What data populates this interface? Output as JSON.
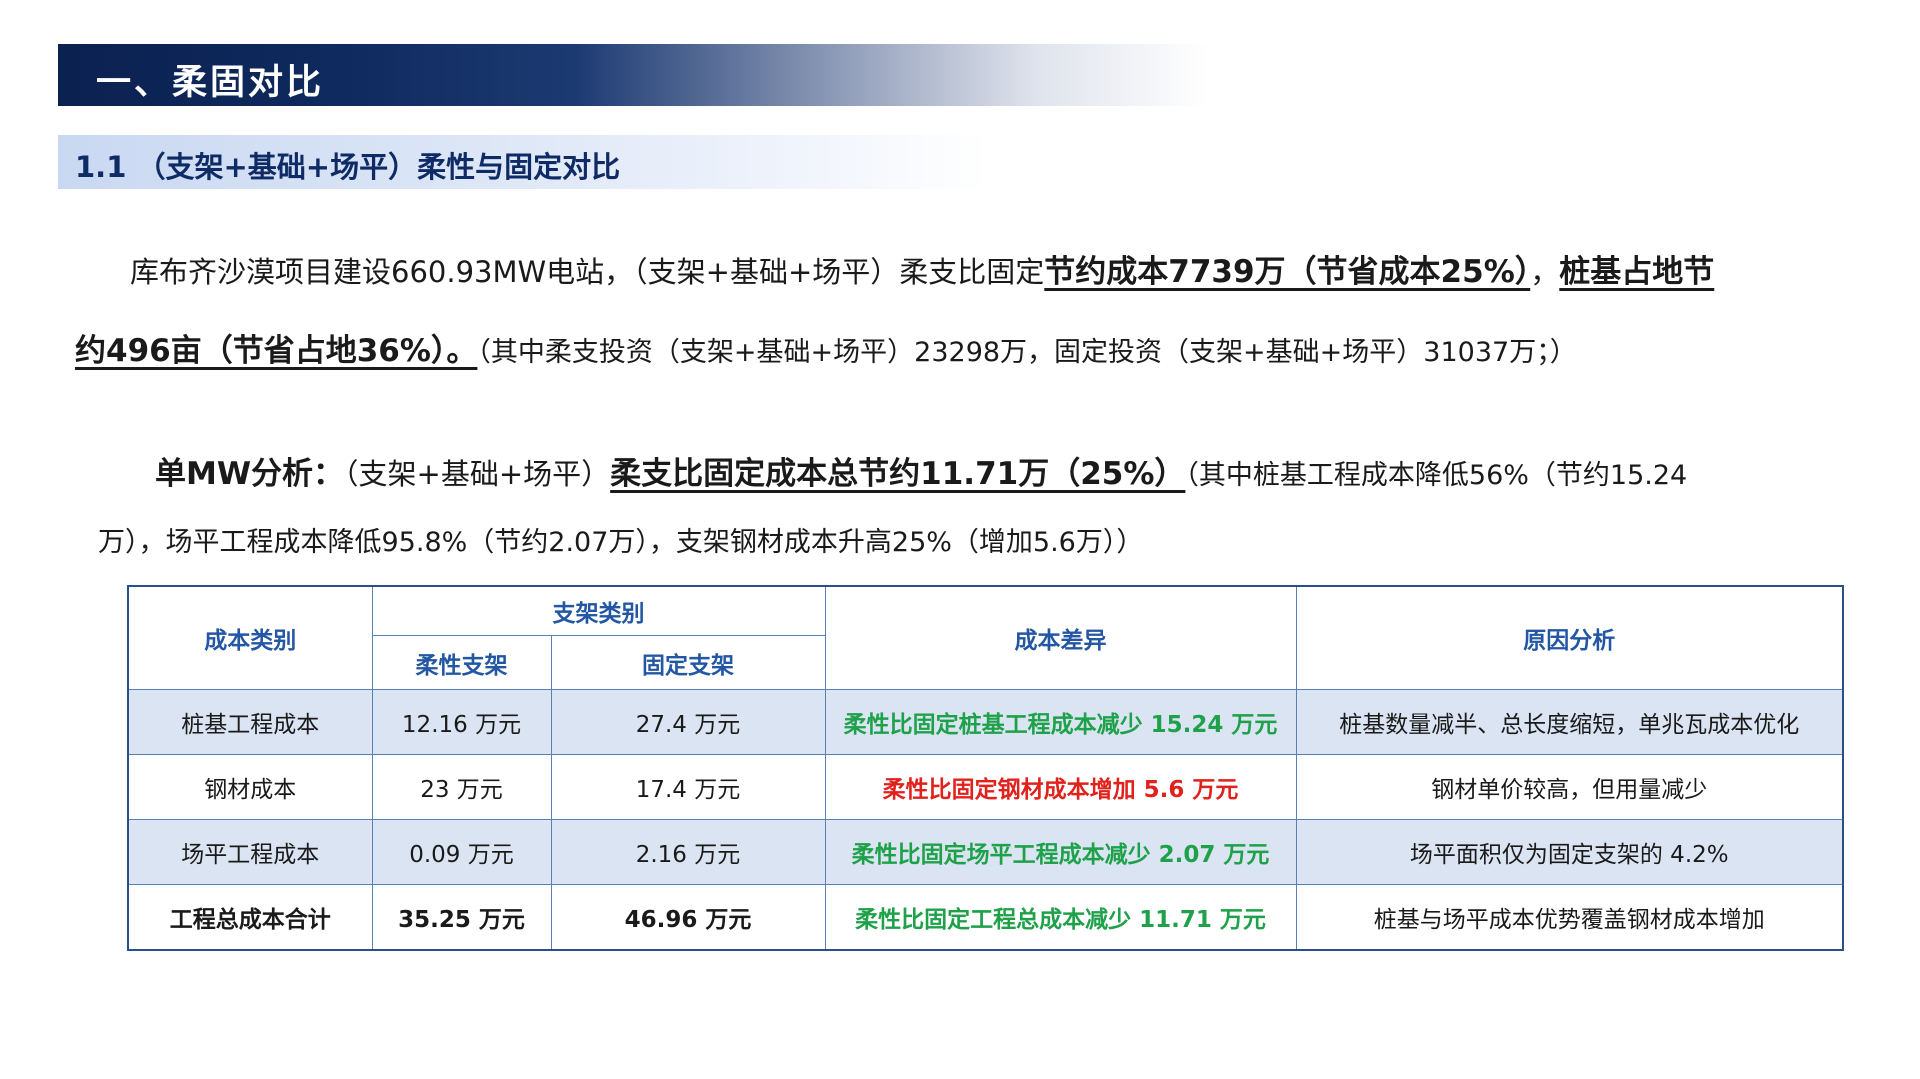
{
  "header": {
    "title": "一、柔固对比",
    "subtitle": "1.1 （支架+基础+场平）柔性与固定对比"
  },
  "paragraph1": {
    "intro": "库布齐沙漠项目建设660.93MW电站，（支架+基础+场平）柔支比固定",
    "highlight_a": "节约成本7739万（节省成本25%）",
    "sep": "，",
    "highlight_b1": "桩基占地节",
    "highlight_b2": "约496亩（节省占地36%）。",
    "note": "（其中柔支投资（支架+基础+场平）23298万，固定投资（支架+基础+场平）31037万；）"
  },
  "paragraph2": {
    "label": "单MW分析：",
    "intro": "（支架+基础+场平）",
    "highlight": "柔支比固定成本总节约11.71万（25%）",
    "note1": "（其中桩基工程成本降低56%（节约15.24",
    "note2": "万），场平工程成本降低95.8%（节约2.07万），支架钢材成本升高25%（增加5.6万））"
  },
  "table": {
    "headers": {
      "category": "成本类别",
      "bracket_type": "支架类别",
      "flexible": "柔性支架",
      "fixed": "固定支架",
      "difference": "成本差异",
      "reason": "原因分析"
    },
    "rows": [
      {
        "category": "桩基工程成本",
        "flexible": "12.16 万元",
        "fixed": "27.4 万元",
        "difference": "柔性比固定桩基工程成本减少 15.24 万元",
        "reason": "桩基数量减半、总长度缩短，单兆瓦成本优化"
      },
      {
        "category": "钢材成本",
        "flexible": "23 万元",
        "fixed": "17.4 万元",
        "difference": "柔性比固定钢材成本增加 5.6 万元",
        "reason": "钢材单价较高，但用量减少"
      },
      {
        "category": "场平工程成本",
        "flexible": "0.09 万元",
        "fixed": "2.16 万元",
        "difference": "柔性比固定场平工程成本减少 2.07 万元",
        "reason": "场平面积仅为固定支架的 4.2%"
      },
      {
        "category": "工程总成本合计",
        "flexible": "35.25 万元",
        "fixed": "46.96 万元",
        "difference": "柔性比固定工程总成本减少 11.71 万元",
        "reason": "桩基与场平成本优势覆盖钢材成本增加"
      }
    ]
  },
  "colors": {
    "title_bg": "#0b2150",
    "accent_blue": "#2357a3",
    "saving_green": "#1fa14a",
    "increase_red": "#e0211c",
    "row_shade": "#dbe4f2"
  }
}
